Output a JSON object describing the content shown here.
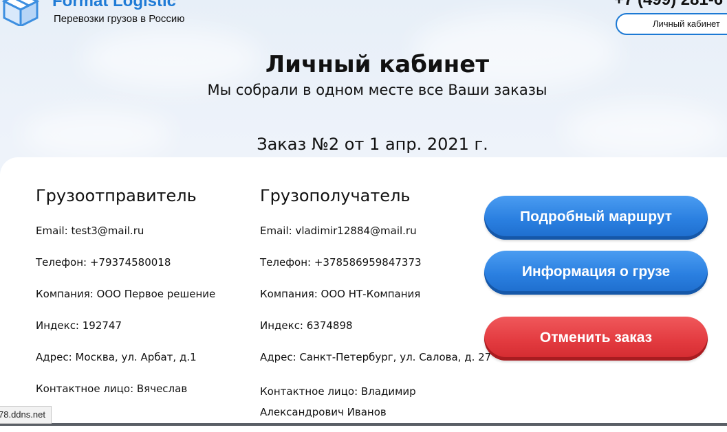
{
  "header": {
    "brand_name": "Format Logistic",
    "tagline": "Перевозки грузов в Россию",
    "phone": "+7 (499) 281-6",
    "cabinet_button": "Личный кабинет"
  },
  "hero": {
    "title": "Личный кабинет",
    "subtitle": "Мы собрали в одном месте все Ваши заказы",
    "order_title": "Заказ №2 от 1 апр. 2021 г."
  },
  "sender": {
    "heading": "Грузоотправитель",
    "email": "Email: test3@mail.ru",
    "phone": "Телефон: +79374580018",
    "company": "Компания: ООО Первое решение",
    "index": "Индекс: 192747",
    "address": "Адрес: Москва, ул. Арбат, д.1",
    "contact": "Контактное лицо: Вячеслав"
  },
  "receiver": {
    "heading": "Грузополучатель",
    "email": "Email: vladimir12884@mail.ru",
    "phone": "Телефон: +378586959847373",
    "company": "Компания: ООО НТ-Компания",
    "index": "Индекс: 6374898",
    "address": "Адрес: Санкт-Петербург, ул. Салова, д. 27",
    "contact": "Контактное лицо: Владимир Александрович Иванов"
  },
  "actions": {
    "route_button": "Подробный маршрут",
    "cargo_info_button": "Информация о грузе",
    "cancel_button": "Отменить заказ"
  },
  "status_bar": {
    "url": "78.ddns.net"
  },
  "colors": {
    "brand_blue": "#1f7bd6",
    "button_blue": "#2a7fe0",
    "button_red": "#e33b40"
  }
}
